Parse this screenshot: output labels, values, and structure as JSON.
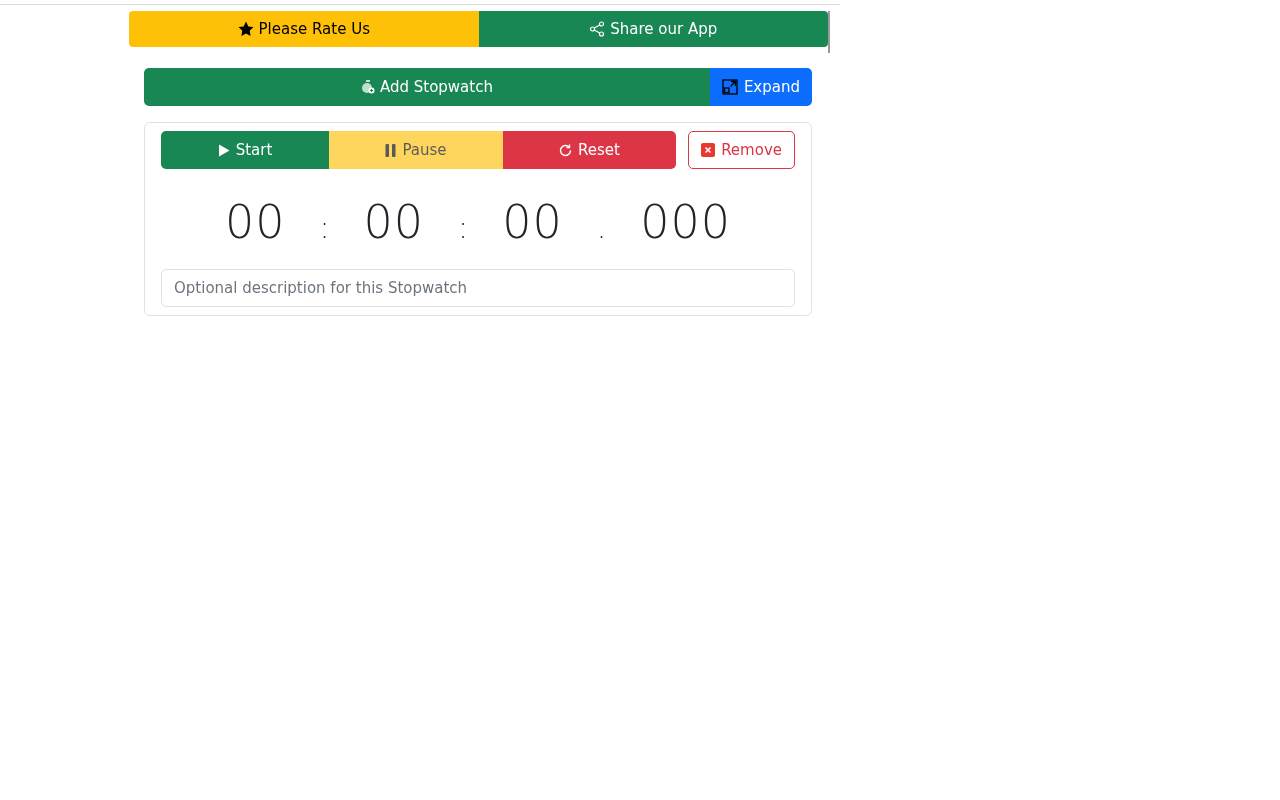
{
  "top_actions": [
    {
      "label": "Please Rate Us",
      "kind": "rate"
    },
    {
      "label": "Share our App",
      "kind": "share"
    }
  ],
  "toolbar": {
    "add_label": "Add Stopwatch",
    "expand_label": "Expand"
  },
  "stopwatch": {
    "controls": [
      {
        "label": "Start",
        "kind": "start",
        "disabled": false
      },
      {
        "label": "Pause",
        "kind": "pause",
        "disabled": true
      },
      {
        "label": "Reset",
        "kind": "reset",
        "disabled": false
      }
    ],
    "remove_label": "Remove",
    "time": [
      {
        "text": "00",
        "kind": "digits"
      },
      {
        "text": ":",
        "kind": "separator"
      },
      {
        "text": "00",
        "kind": "digits"
      },
      {
        "text": ":",
        "kind": "separator"
      },
      {
        "text": "00",
        "kind": "digits"
      },
      {
        "text": ".",
        "kind": "separator"
      },
      {
        "text": "000",
        "kind": "digits"
      }
    ],
    "description": {
      "placeholder": "Optional description for this Stopwatch"
    }
  }
}
